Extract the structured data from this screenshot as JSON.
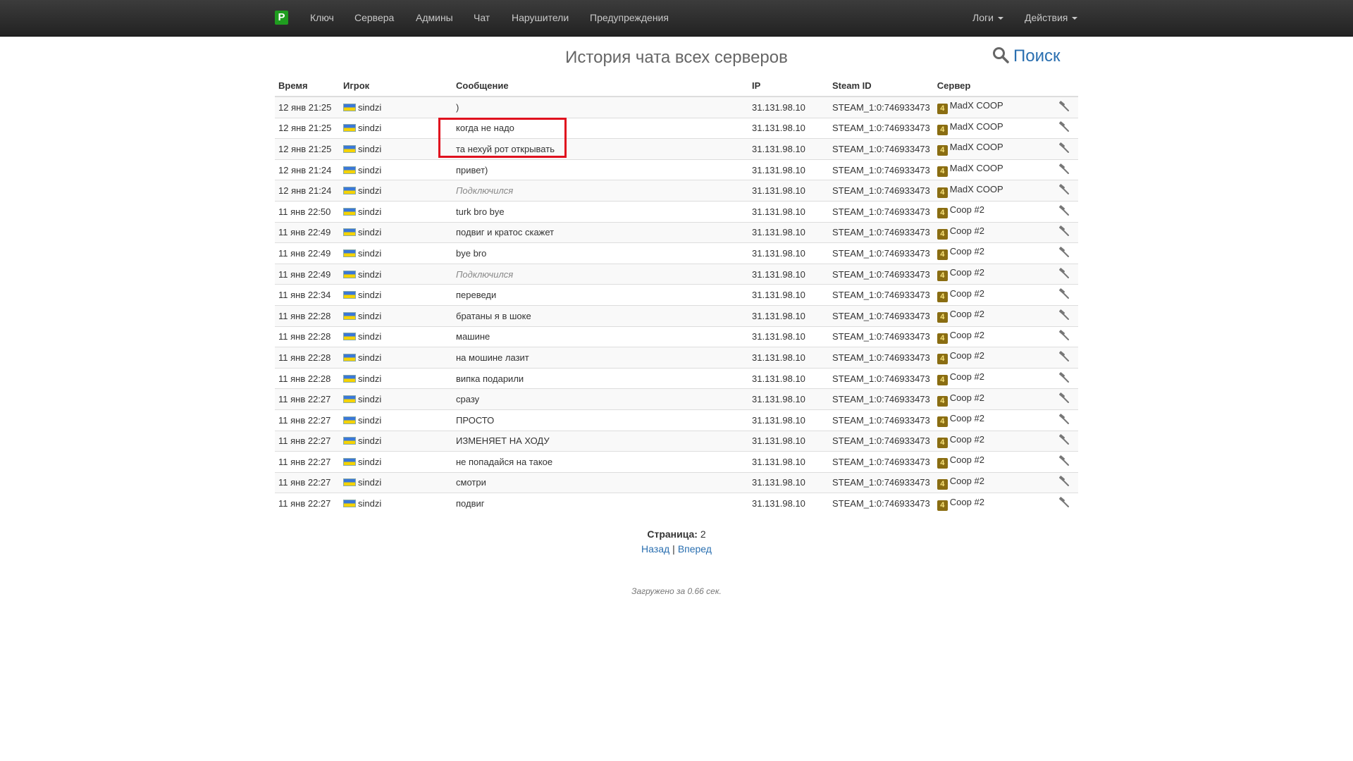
{
  "nav": {
    "brand": "P",
    "links": [
      "Ключ",
      "Сервера",
      "Админы",
      "Чат",
      "Нарушители",
      "Предупреждения"
    ],
    "logs": "Логи",
    "actions": "Действия"
  },
  "page": {
    "title": "История чата всех серверов",
    "search": "Поиск"
  },
  "table": {
    "headers": [
      "Время",
      "Игрок",
      "Сообщение",
      "IP",
      "Steam ID",
      "Сервер"
    ],
    "rows": [
      {
        "time": "12 янв 21:25",
        "player": "sindzi",
        "message": ")",
        "system": false,
        "ip": "31.131.98.10",
        "steam": "STEAM_1:0:746933473",
        "server": "MadX COOP"
      },
      {
        "time": "12 янв 21:25",
        "player": "sindzi",
        "message": "когда не надо",
        "system": false,
        "ip": "31.131.98.10",
        "steam": "STEAM_1:0:746933473",
        "server": "MadX COOP"
      },
      {
        "time": "12 янв 21:25",
        "player": "sindzi",
        "message": "та нехуй рот открывать",
        "system": false,
        "ip": "31.131.98.10",
        "steam": "STEAM_1:0:746933473",
        "server": "MadX COOP"
      },
      {
        "time": "12 янв 21:24",
        "player": "sindzi",
        "message": "привет)",
        "system": false,
        "ip": "31.131.98.10",
        "steam": "STEAM_1:0:746933473",
        "server": "MadX COOP"
      },
      {
        "time": "12 янв 21:24",
        "player": "sindzi",
        "message": "Подключился",
        "system": true,
        "ip": "31.131.98.10",
        "steam": "STEAM_1:0:746933473",
        "server": "MadX COOP"
      },
      {
        "time": "11 янв 22:50",
        "player": "sindzi",
        "message": "turk bro bye",
        "system": false,
        "ip": "31.131.98.10",
        "steam": "STEAM_1:0:746933473",
        "server": "Coop #2"
      },
      {
        "time": "11 янв 22:49",
        "player": "sindzi",
        "message": "подвиг и кратос скажет",
        "system": false,
        "ip": "31.131.98.10",
        "steam": "STEAM_1:0:746933473",
        "server": "Coop #2"
      },
      {
        "time": "11 янв 22:49",
        "player": "sindzi",
        "message": "bye bro",
        "system": false,
        "ip": "31.131.98.10",
        "steam": "STEAM_1:0:746933473",
        "server": "Coop #2"
      },
      {
        "time": "11 янв 22:49",
        "player": "sindzi",
        "message": "Подключился",
        "system": true,
        "ip": "31.131.98.10",
        "steam": "STEAM_1:0:746933473",
        "server": "Coop #2"
      },
      {
        "time": "11 янв 22:34",
        "player": "sindzi",
        "message": "переведи",
        "system": false,
        "ip": "31.131.98.10",
        "steam": "STEAM_1:0:746933473",
        "server": "Coop #2"
      },
      {
        "time": "11 янв 22:28",
        "player": "sindzi",
        "message": "братаны я в шоке",
        "system": false,
        "ip": "31.131.98.10",
        "steam": "STEAM_1:0:746933473",
        "server": "Coop #2"
      },
      {
        "time": "11 янв 22:28",
        "player": "sindzi",
        "message": "машине",
        "system": false,
        "ip": "31.131.98.10",
        "steam": "STEAM_1:0:746933473",
        "server": "Coop #2"
      },
      {
        "time": "11 янв 22:28",
        "player": "sindzi",
        "message": "на мошине лазит",
        "system": false,
        "ip": "31.131.98.10",
        "steam": "STEAM_1:0:746933473",
        "server": "Coop #2"
      },
      {
        "time": "11 янв 22:28",
        "player": "sindzi",
        "message": "випка подарили",
        "system": false,
        "ip": "31.131.98.10",
        "steam": "STEAM_1:0:746933473",
        "server": "Coop #2"
      },
      {
        "time": "11 янв 22:27",
        "player": "sindzi",
        "message": "сразу",
        "system": false,
        "ip": "31.131.98.10",
        "steam": "STEAM_1:0:746933473",
        "server": "Coop #2"
      },
      {
        "time": "11 янв 22:27",
        "player": "sindzi",
        "message": "ПРОСТО",
        "system": false,
        "ip": "31.131.98.10",
        "steam": "STEAM_1:0:746933473",
        "server": "Coop #2"
      },
      {
        "time": "11 янв 22:27",
        "player": "sindzi",
        "message": "ИЗМЕНЯЕТ НА ХОДУ",
        "system": false,
        "ip": "31.131.98.10",
        "steam": "STEAM_1:0:746933473",
        "server": "Coop #2"
      },
      {
        "time": "11 янв 22:27",
        "player": "sindzi",
        "message": "не попадайся на такое",
        "system": false,
        "ip": "31.131.98.10",
        "steam": "STEAM_1:0:746933473",
        "server": "Coop #2"
      },
      {
        "time": "11 янв 22:27",
        "player": "sindzi",
        "message": "смотри",
        "system": false,
        "ip": "31.131.98.10",
        "steam": "STEAM_1:0:746933473",
        "server": "Coop #2"
      },
      {
        "time": "11 янв 22:27",
        "player": "sindzi",
        "message": "подвиг",
        "system": false,
        "ip": "31.131.98.10",
        "steam": "STEAM_1:0:746933473",
        "server": "Coop #2"
      }
    ]
  },
  "pagination": {
    "label": "Страница:",
    "page": "2",
    "prev": "Назад",
    "separator": "|",
    "next": "Вперед"
  },
  "footer": "Загружено за 0.66 сек.",
  "colors": {
    "accent": "#2a6fb0",
    "highlight": "#e0101e",
    "brand": "#1f9d1f"
  }
}
